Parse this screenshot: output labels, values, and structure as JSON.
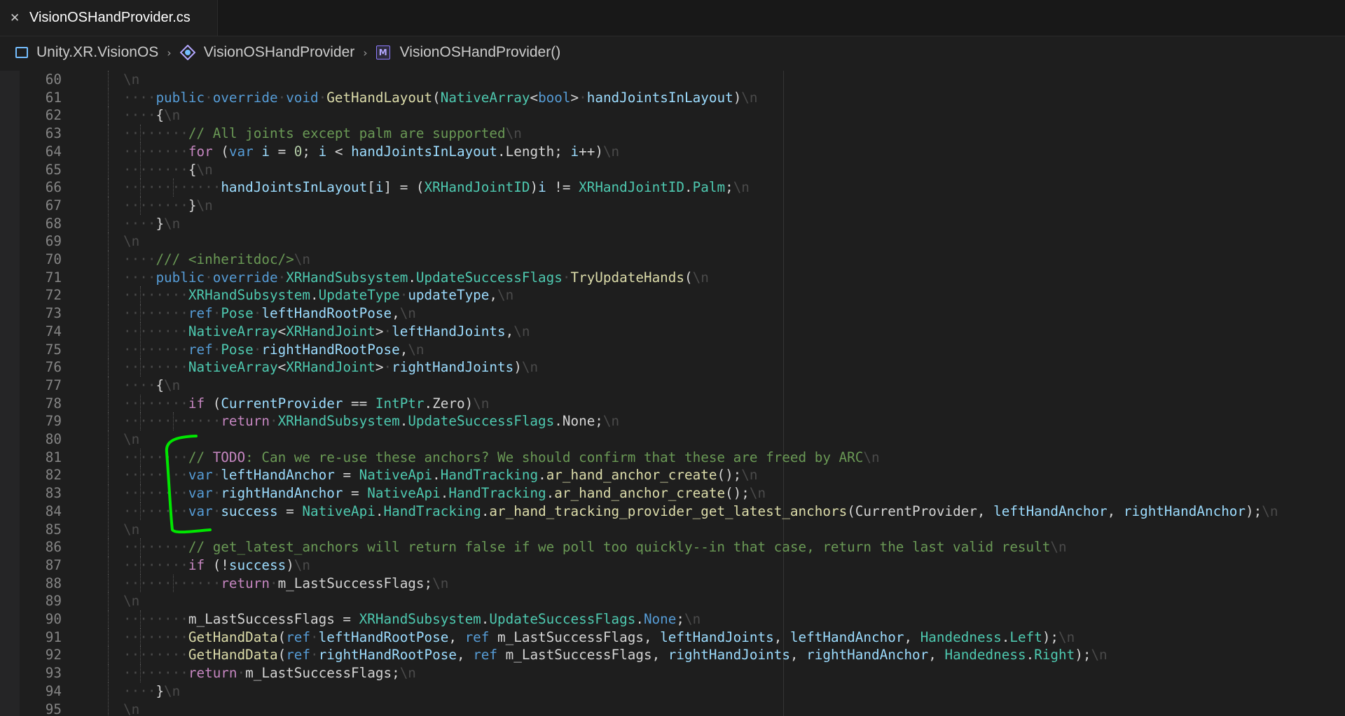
{
  "tab": {
    "close_icon": "close-icon",
    "title": "VisionOSHandProvider.cs"
  },
  "breadcrumb": [
    {
      "icon": "namespace-icon",
      "label": "Unity.XR.VisionOS"
    },
    {
      "icon": "class-icon",
      "label": "VisionOSHandProvider"
    },
    {
      "icon": "method-icon",
      "label": "VisionOSHandProvider()"
    }
  ],
  "whitespace_marker": "\\n",
  "colors": {
    "annotation_bracket": "#00e600"
  },
  "code_lines": [
    {
      "n": "60",
      "indent": 0,
      "tokens": []
    },
    {
      "n": "61",
      "indent": 1,
      "tokens": [
        [
          "kw",
          "public"
        ],
        [
          "ws",
          " "
        ],
        [
          "kw",
          "override"
        ],
        [
          "ws",
          " "
        ],
        [
          "kw",
          "void"
        ],
        [
          "ws",
          " "
        ],
        [
          "fn",
          "GetHandLayout"
        ],
        [
          "pl",
          "("
        ],
        [
          "ty",
          "NativeArray"
        ],
        [
          "pl",
          "<"
        ],
        [
          "kw",
          "bool"
        ],
        [
          "pl",
          ">"
        ],
        [
          "ws",
          " "
        ],
        [
          "vr",
          "handJointsInLayout"
        ],
        [
          "pl",
          ")"
        ]
      ]
    },
    {
      "n": "62",
      "indent": 1,
      "tokens": [
        [
          "pl",
          "{"
        ]
      ]
    },
    {
      "n": "63",
      "indent": 2,
      "tokens": [
        [
          "cm",
          "// All joints except palm are supported"
        ]
      ]
    },
    {
      "n": "64",
      "indent": 2,
      "tokens": [
        [
          "ctl",
          "for"
        ],
        [
          "pl",
          " ("
        ],
        [
          "kw",
          "var"
        ],
        [
          "vr",
          " i"
        ],
        [
          "pl",
          " = "
        ],
        [
          "nu",
          "0"
        ],
        [
          "pl",
          "; "
        ],
        [
          "vr",
          "i"
        ],
        [
          "pl",
          " < "
        ],
        [
          "vr",
          "handJointsInLayout"
        ],
        [
          "pl",
          ".Length; "
        ],
        [
          "vr",
          "i"
        ],
        [
          "pl",
          "++)"
        ]
      ]
    },
    {
      "n": "65",
      "indent": 2,
      "tokens": [
        [
          "pl",
          "{"
        ]
      ]
    },
    {
      "n": "66",
      "indent": 3,
      "tokens": [
        [
          "vr",
          "handJointsInLayout"
        ],
        [
          "pl",
          "["
        ],
        [
          "vr",
          "i"
        ],
        [
          "pl",
          "] = ("
        ],
        [
          "ty",
          "XRHandJointID"
        ],
        [
          "pl",
          ")"
        ],
        [
          "vr",
          "i"
        ],
        [
          "pl",
          " != "
        ],
        [
          "ty",
          "XRHandJointID"
        ],
        [
          "pl",
          "."
        ],
        [
          "ty",
          "Palm"
        ],
        [
          "pl",
          ";"
        ]
      ]
    },
    {
      "n": "67",
      "indent": 2,
      "tokens": [
        [
          "pl",
          "}"
        ]
      ]
    },
    {
      "n": "68",
      "indent": 1,
      "tokens": [
        [
          "pl",
          "}"
        ]
      ]
    },
    {
      "n": "69",
      "indent": 0,
      "tokens": []
    },
    {
      "n": "70",
      "indent": 1,
      "tokens": [
        [
          "cm",
          "/// <inheritdoc/>"
        ]
      ]
    },
    {
      "n": "71",
      "indent": 1,
      "tokens": [
        [
          "kw",
          "public"
        ],
        [
          "ws",
          " "
        ],
        [
          "kw",
          "override"
        ],
        [
          "ws",
          " "
        ],
        [
          "ty",
          "XRHandSubsystem"
        ],
        [
          "pl",
          "."
        ],
        [
          "ty",
          "UpdateSuccessFlags"
        ],
        [
          "ws",
          " "
        ],
        [
          "fn",
          "TryUpdateHands"
        ],
        [
          "pl",
          "("
        ]
      ]
    },
    {
      "n": "72",
      "indent": 2,
      "tokens": [
        [
          "ty",
          "XRHandSubsystem"
        ],
        [
          "pl",
          "."
        ],
        [
          "ty",
          "UpdateType"
        ],
        [
          "ws",
          " "
        ],
        [
          "vr",
          "updateType"
        ],
        [
          "pl",
          ","
        ]
      ]
    },
    {
      "n": "73",
      "indent": 2,
      "tokens": [
        [
          "kw",
          "ref"
        ],
        [
          "ws",
          " "
        ],
        [
          "ty",
          "Pose"
        ],
        [
          "ws",
          " "
        ],
        [
          "vr",
          "leftHandRootPose"
        ],
        [
          "pl",
          ","
        ]
      ]
    },
    {
      "n": "74",
      "indent": 2,
      "tokens": [
        [
          "ty",
          "NativeArray"
        ],
        [
          "pl",
          "<"
        ],
        [
          "ty",
          "XRHandJoint"
        ],
        [
          "pl",
          ">"
        ],
        [
          "ws",
          " "
        ],
        [
          "vr",
          "leftHandJoints"
        ],
        [
          "pl",
          ","
        ]
      ]
    },
    {
      "n": "75",
      "indent": 2,
      "tokens": [
        [
          "kw",
          "ref"
        ],
        [
          "ws",
          " "
        ],
        [
          "ty",
          "Pose"
        ],
        [
          "ws",
          " "
        ],
        [
          "vr",
          "rightHandRootPose"
        ],
        [
          "pl",
          ","
        ]
      ]
    },
    {
      "n": "76",
      "indent": 2,
      "tokens": [
        [
          "ty",
          "NativeArray"
        ],
        [
          "pl",
          "<"
        ],
        [
          "ty",
          "XRHandJoint"
        ],
        [
          "pl",
          ">"
        ],
        [
          "ws",
          " "
        ],
        [
          "vr",
          "rightHandJoints"
        ],
        [
          "pl",
          ")"
        ]
      ]
    },
    {
      "n": "77",
      "indent": 1,
      "tokens": [
        [
          "pl",
          "{"
        ]
      ]
    },
    {
      "n": "78",
      "indent": 2,
      "tokens": [
        [
          "ctl",
          "if"
        ],
        [
          "pl",
          " ("
        ],
        [
          "vr",
          "CurrentProvider"
        ],
        [
          "pl",
          " == "
        ],
        [
          "ty",
          "IntPtr"
        ],
        [
          "pl",
          ".Zero)"
        ]
      ]
    },
    {
      "n": "79",
      "indent": 3,
      "tokens": [
        [
          "ctl",
          "return"
        ],
        [
          "ws",
          " "
        ],
        [
          "ty",
          "XRHandSubsystem"
        ],
        [
          "pl",
          "."
        ],
        [
          "ty",
          "UpdateSuccessFlags"
        ],
        [
          "pl",
          ".None;"
        ]
      ]
    },
    {
      "n": "80",
      "indent": 0,
      "tokens": []
    },
    {
      "n": "81",
      "indent": 2,
      "tokens": [
        [
          "cm",
          "// "
        ],
        [
          "td",
          "TODO"
        ],
        [
          "cm",
          ": Can we re-use these anchors? We should confirm that these are freed by ARC"
        ]
      ]
    },
    {
      "n": "82",
      "indent": 2,
      "tokens": [
        [
          "kw",
          "var"
        ],
        [
          "ws",
          " "
        ],
        [
          "vr",
          "leftHandAnchor"
        ],
        [
          "pl",
          " = "
        ],
        [
          "ty",
          "NativeApi"
        ],
        [
          "pl",
          "."
        ],
        [
          "ty",
          "HandTracking"
        ],
        [
          "pl",
          "."
        ],
        [
          "fn",
          "ar_hand_anchor_create"
        ],
        [
          "pl",
          "();"
        ]
      ]
    },
    {
      "n": "83",
      "indent": 2,
      "tokens": [
        [
          "kw",
          "var"
        ],
        [
          "ws",
          " "
        ],
        [
          "vr",
          "rightHandAnchor"
        ],
        [
          "pl",
          " = "
        ],
        [
          "ty",
          "NativeApi"
        ],
        [
          "pl",
          "."
        ],
        [
          "ty",
          "HandTracking"
        ],
        [
          "pl",
          "."
        ],
        [
          "fn",
          "ar_hand_anchor_create"
        ],
        [
          "pl",
          "();"
        ]
      ]
    },
    {
      "n": "84",
      "indent": 2,
      "tokens": [
        [
          "kw",
          "var"
        ],
        [
          "ws",
          " "
        ],
        [
          "vr",
          "success"
        ],
        [
          "pl",
          " = "
        ],
        [
          "ty",
          "NativeApi"
        ],
        [
          "pl",
          "."
        ],
        [
          "ty",
          "HandTracking"
        ],
        [
          "pl",
          "."
        ],
        [
          "fn",
          "ar_hand_tracking_provider_get_latest_anchors"
        ],
        [
          "pl",
          "(CurrentProvider, "
        ],
        [
          "vr",
          "leftHandAnchor"
        ],
        [
          "pl",
          ", "
        ],
        [
          "vr",
          "rightHandAnchor"
        ],
        [
          "pl",
          ");"
        ]
      ]
    },
    {
      "n": "85",
      "indent": 0,
      "tokens": []
    },
    {
      "n": "86",
      "indent": 2,
      "tokens": [
        [
          "cm",
          "// get_latest_anchors will return false if we poll too quickly--in that case, return the last valid result"
        ]
      ]
    },
    {
      "n": "87",
      "indent": 2,
      "tokens": [
        [
          "ctl",
          "if"
        ],
        [
          "pl",
          " (!"
        ],
        [
          "vr",
          "success"
        ],
        [
          "pl",
          ")"
        ]
      ]
    },
    {
      "n": "88",
      "indent": 3,
      "tokens": [
        [
          "ctl",
          "return"
        ],
        [
          "ws",
          " "
        ],
        [
          "pl",
          "m_LastSuccessFlags;"
        ]
      ]
    },
    {
      "n": "89",
      "indent": 0,
      "tokens": []
    },
    {
      "n": "90",
      "indent": 2,
      "tokens": [
        [
          "pl",
          "m_LastSuccessFlags = "
        ],
        [
          "ty",
          "XRHandSubsystem"
        ],
        [
          "pl",
          "."
        ],
        [
          "ty",
          "UpdateSuccessFlags"
        ],
        [
          "pl",
          "."
        ],
        [
          "kw",
          "None"
        ],
        [
          "pl",
          ";"
        ]
      ]
    },
    {
      "n": "91",
      "indent": 2,
      "tokens": [
        [
          "fn",
          "GetHandData"
        ],
        [
          "pl",
          "("
        ],
        [
          "kw",
          "ref"
        ],
        [
          "ws",
          " "
        ],
        [
          "vr",
          "leftHandRootPose"
        ],
        [
          "pl",
          ", "
        ],
        [
          "kw",
          "ref"
        ],
        [
          "pl",
          " m_LastSuccessFlags, "
        ],
        [
          "vr",
          "leftHandJoints"
        ],
        [
          "pl",
          ", "
        ],
        [
          "vr",
          "leftHandAnchor"
        ],
        [
          "pl",
          ", "
        ],
        [
          "ty",
          "Handedness"
        ],
        [
          "pl",
          "."
        ],
        [
          "ty",
          "Left"
        ],
        [
          "pl",
          ");"
        ]
      ]
    },
    {
      "n": "92",
      "indent": 2,
      "tokens": [
        [
          "fn",
          "GetHandData"
        ],
        [
          "pl",
          "("
        ],
        [
          "kw",
          "ref"
        ],
        [
          "ws",
          " "
        ],
        [
          "vr",
          "rightHandRootPose"
        ],
        [
          "pl",
          ", "
        ],
        [
          "kw",
          "ref"
        ],
        [
          "pl",
          " m_LastSuccessFlags, "
        ],
        [
          "vr",
          "rightHandJoints"
        ],
        [
          "pl",
          ", "
        ],
        [
          "vr",
          "rightHandAnchor"
        ],
        [
          "pl",
          ", "
        ],
        [
          "ty",
          "Handedness"
        ],
        [
          "pl",
          "."
        ],
        [
          "ty",
          "Right"
        ],
        [
          "pl",
          ");"
        ]
      ]
    },
    {
      "n": "93",
      "indent": 2,
      "tokens": [
        [
          "ctl",
          "return"
        ],
        [
          "ws",
          " "
        ],
        [
          "pl",
          "m_LastSuccessFlags;"
        ]
      ]
    },
    {
      "n": "94",
      "indent": 1,
      "tokens": [
        [
          "pl",
          "}"
        ]
      ]
    },
    {
      "n": "95",
      "indent": 0,
      "tokens": []
    }
  ]
}
